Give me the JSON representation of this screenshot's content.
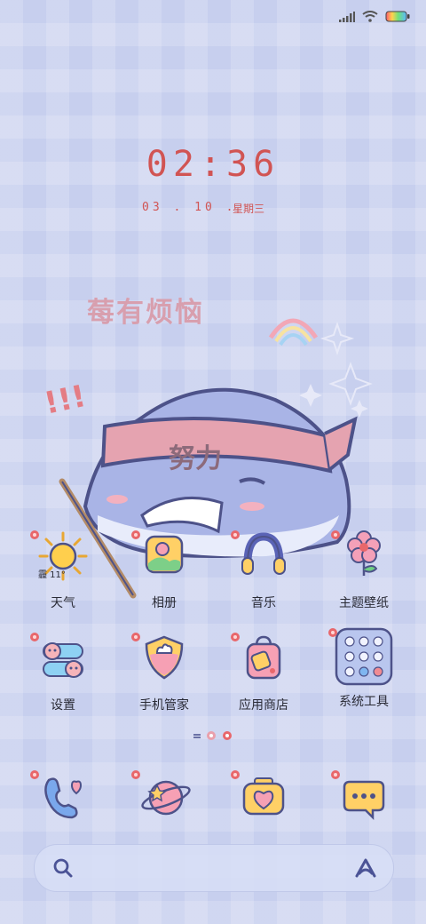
{
  "clock": {
    "time": "02:36",
    "date": "03 . 10 .",
    "weekday": "星期三"
  },
  "wallpaper": {
    "caption": "莓有烦恼",
    "headband": "努力",
    "exclaim": "!!!"
  },
  "weather": {
    "temp": "霾 11°"
  },
  "apps_row1": [
    {
      "label": "天气",
      "icon": "sun-icon"
    },
    {
      "label": "相册",
      "icon": "gallery-icon"
    },
    {
      "label": "音乐",
      "icon": "headphones-icon"
    },
    {
      "label": "主题壁纸",
      "icon": "flower-icon"
    }
  ],
  "apps_row2": [
    {
      "label": "设置",
      "icon": "settings-icon"
    },
    {
      "label": "手机管家",
      "icon": "security-icon"
    },
    {
      "label": "应用商店",
      "icon": "store-bag-icon"
    },
    {
      "label": "系统工具",
      "icon": "tools-folder-icon"
    }
  ],
  "dock": [
    {
      "icon": "phone-icon"
    },
    {
      "icon": "browser-planet-icon"
    },
    {
      "icon": "camera-icon"
    },
    {
      "icon": "messages-icon"
    }
  ],
  "search": {
    "icon": "search-icon",
    "assistant_icon": "assistant-icon"
  },
  "colors": {
    "accent": "#d15453",
    "background": "#c7cfee",
    "text": "#2a2b36"
  }
}
